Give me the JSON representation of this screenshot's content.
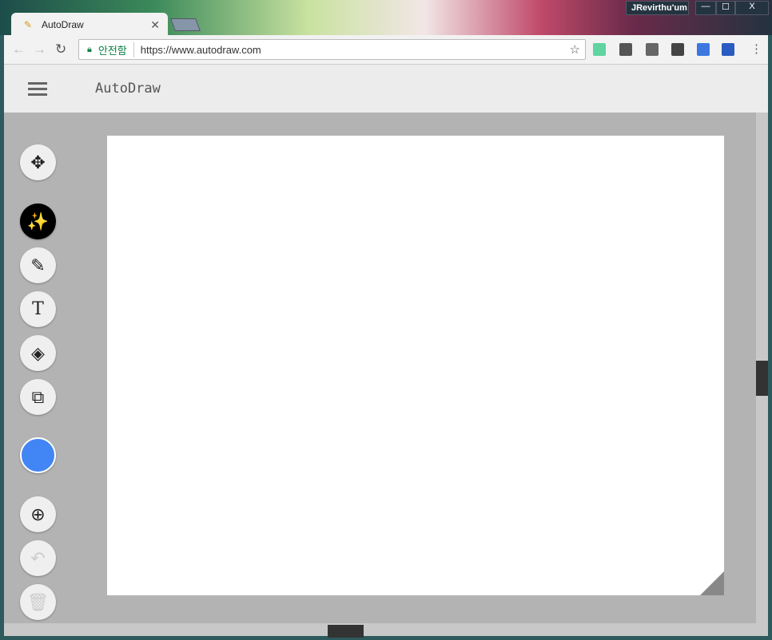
{
  "browser": {
    "tab_title": "AutoDraw",
    "profile": "JRevirthu'um",
    "secure_label": "안전함",
    "url": "https://www.autodraw.com",
    "min": "—",
    "max": "☐",
    "close": "X"
  },
  "app": {
    "title": "AutoDraw",
    "color_selected": "#4285f4"
  },
  "tools": [
    "move",
    "autodraw",
    "draw",
    "type",
    "fill",
    "shape",
    "color",
    "zoom",
    "undo",
    "delete"
  ]
}
